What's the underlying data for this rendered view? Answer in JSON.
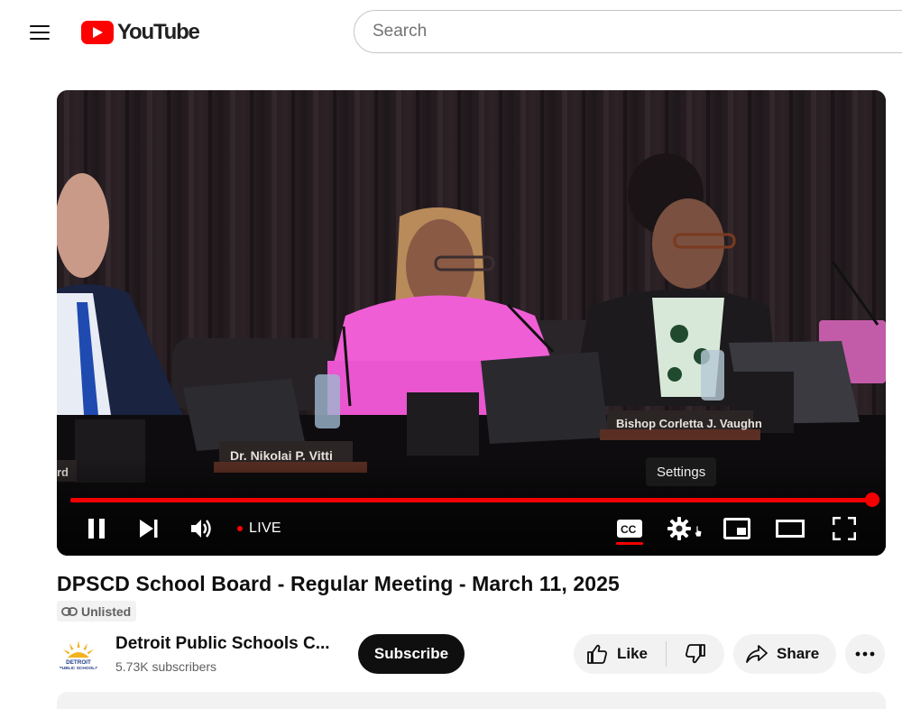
{
  "app": {
    "logo_text": "YouTube",
    "brand_color": "#ff0000"
  },
  "search": {
    "placeholder": "Search",
    "value": ""
  },
  "player": {
    "live_label": "LIVE",
    "tooltip": "Settings",
    "progress_fraction": 1.0,
    "accent_color": "#f50000",
    "nameplates": [
      "Dr. Nikolai P. Vitti",
      "Bishop Corletta J. Vaughn",
      "rd"
    ],
    "controls": [
      "pause-icon",
      "next-icon",
      "volume-icon",
      "captions-icon",
      "settings-icon",
      "miniplayer-icon",
      "theater-icon",
      "fullscreen-icon"
    ],
    "captions_on": true
  },
  "video": {
    "title": "DPSCD School Board - Regular Meeting - March 11, 2025",
    "visibility_badge": "Unlisted"
  },
  "channel": {
    "name": "Detroit Public Schools C...",
    "subscribers": "5.73K subscribers",
    "subscribe_label": "Subscribe",
    "avatar_text_line1": "DETROIT",
    "avatar_text_line2": "PUBLIC SCHOOLS"
  },
  "actions": {
    "like_label": "Like",
    "share_label": "Share"
  }
}
